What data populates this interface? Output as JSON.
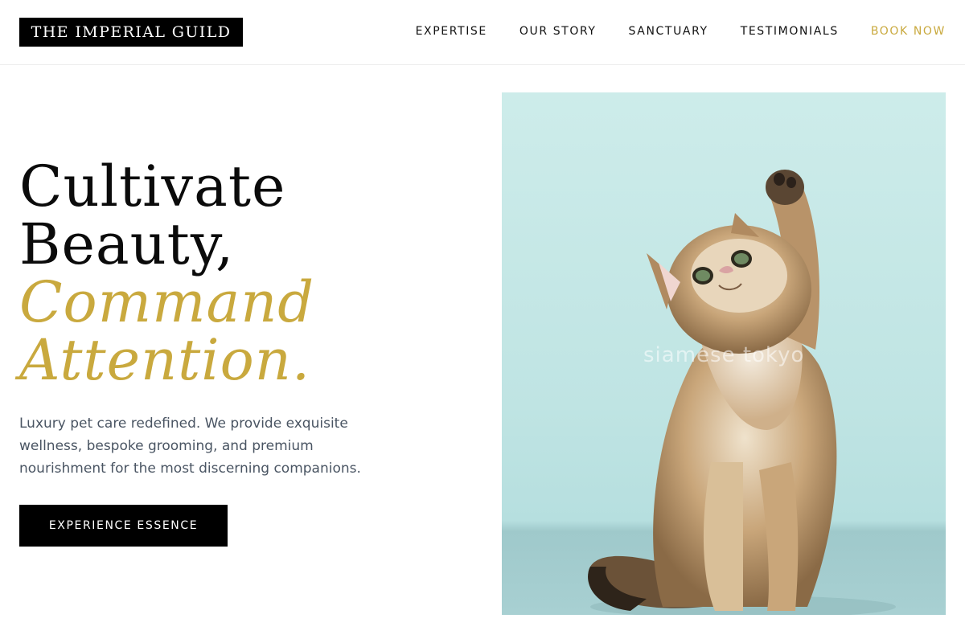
{
  "brand": {
    "name": "THE IMPERIAL GUILD"
  },
  "nav": {
    "items": [
      "EXPERTISE",
      "OUR STORY",
      "SANCTUARY",
      "TESTIMONIALS"
    ],
    "cta": "BOOK NOW"
  },
  "hero": {
    "headline": [
      "Cultivate",
      "Beauty,",
      "Command",
      "Attention."
    ],
    "subcopy": "Luxury pet care redefined. We provide exquisite wellness, bespoke grooming, and premium nourishment for the most discerning companions.",
    "button_label": "EXPERIENCE ESSENCE",
    "image_alt": "kitten raising paw",
    "watermark": "siamese tokyo"
  },
  "colors": {
    "accent_gold": "#c9a93e",
    "background": "#ffffff",
    "button": "#000000",
    "image_bg": "#c6e8e6"
  }
}
